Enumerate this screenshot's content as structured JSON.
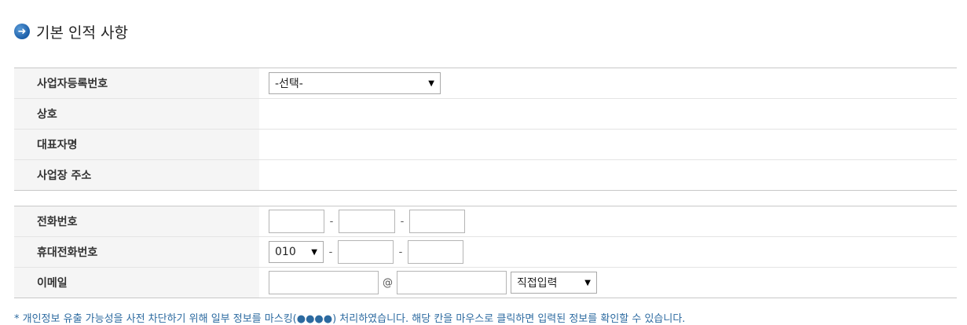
{
  "section": {
    "title": "기본 인적 사항"
  },
  "business": {
    "reg_no_label": "사업자등록번호",
    "reg_no_select": "-선택-",
    "company_label": "상호",
    "ceo_label": "대표자명",
    "address_label": "사업장 주소"
  },
  "contact": {
    "phone_label": "전화번호",
    "mobile_label": "휴대전화번호",
    "mobile_prefix": "010",
    "email_label": "이메일",
    "dash": "-",
    "at": "@",
    "domain_select": "직접입력"
  },
  "notice": "* 개인정보 유출 가능성을 사전 차단하기 위해 일부 정보를 마스킹(●●●●) 처리하였습니다. 해당 칸을 마우스로 클릭하면 입력된 정보를 확인할 수 있습니다.",
  "colors": {
    "accent": "#1b5ea8",
    "label_bg": "#f5f5f5",
    "notice": "#2c6aa0"
  },
  "icons": {
    "title": "arrow-right-circle-icon",
    "dropdown": "dropdown-arrow-icon"
  }
}
